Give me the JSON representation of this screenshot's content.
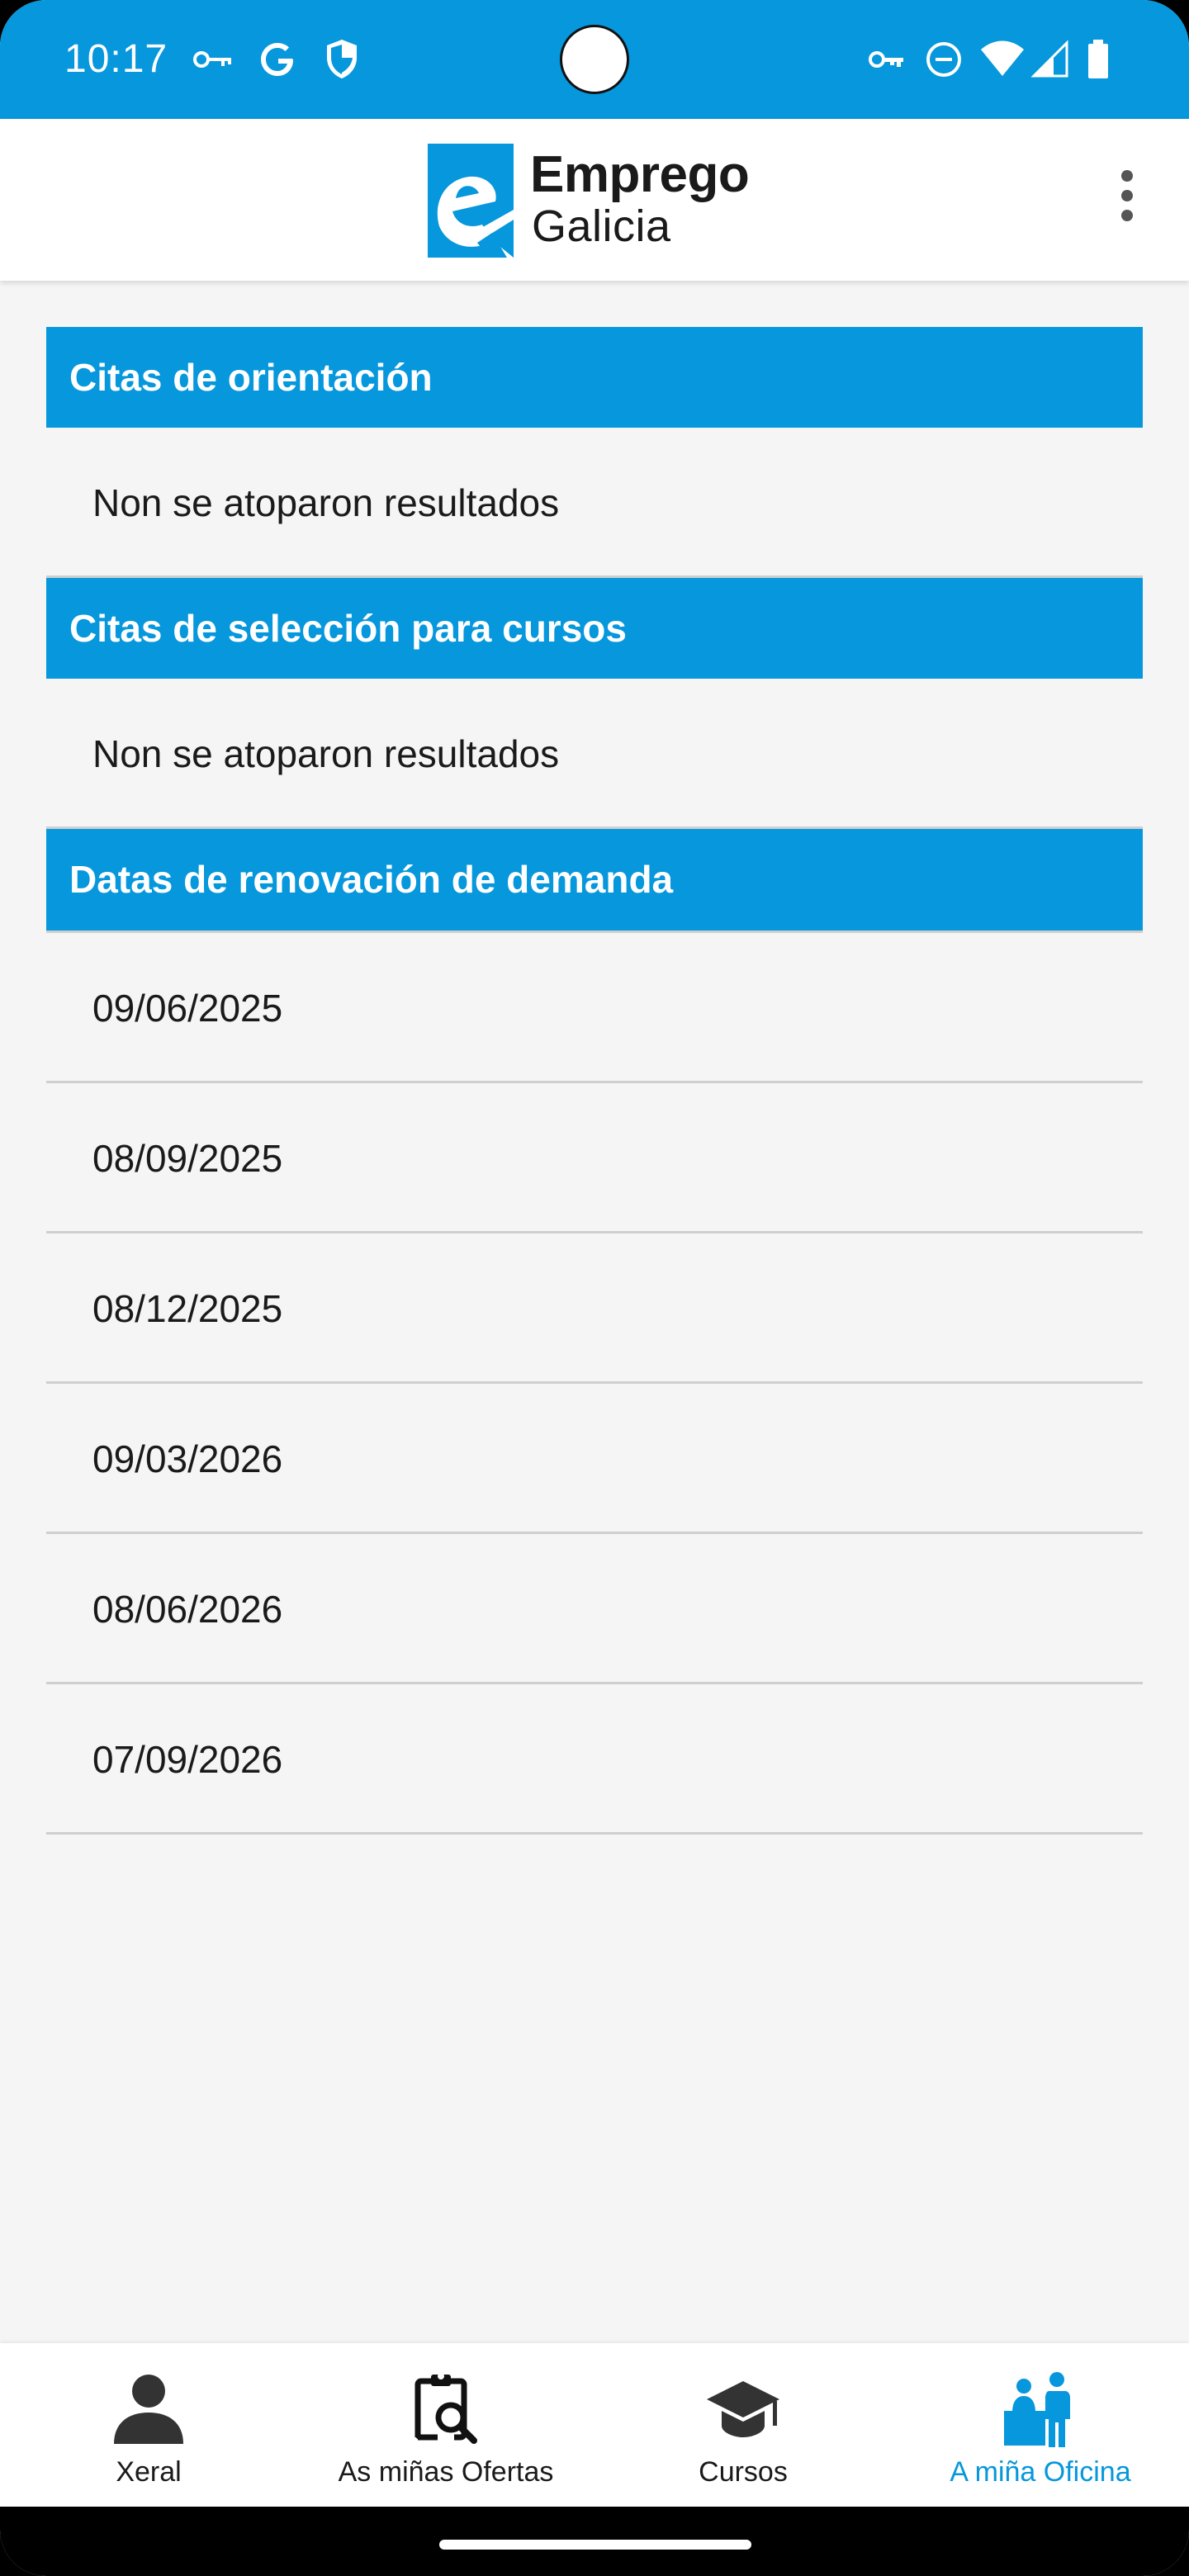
{
  "status_bar": {
    "time": "10:17",
    "left_icons": [
      "key-icon",
      "google-icon",
      "shield-icon"
    ],
    "right_icons": [
      "vpn-key-icon",
      "do-not-disturb-icon",
      "wifi-icon",
      "signal-icon",
      "battery-icon"
    ]
  },
  "app_bar": {
    "logo_line1": "Emprego",
    "logo_line2": "Galicia",
    "menu_icon": "more-vert-icon"
  },
  "sections": [
    {
      "title": "Citas de orientación",
      "rows": [
        "Non se atoparon resultados"
      ]
    },
    {
      "title": "Citas de selección para cursos",
      "rows": [
        "Non se atoparon resultados"
      ]
    },
    {
      "title": "Datas de renovación de demanda",
      "rows": [
        "09/06/2025",
        "08/09/2025",
        "08/12/2025",
        "09/03/2026",
        "08/06/2026",
        "07/09/2026"
      ]
    }
  ],
  "bottom_nav": {
    "items": [
      {
        "label": "Xeral",
        "icon": "person-icon",
        "active": false
      },
      {
        "label": "As miñas Ofertas",
        "icon": "clipboard-search-icon",
        "active": false
      },
      {
        "label": "Cursos",
        "icon": "graduation-cap-icon",
        "active": false
      },
      {
        "label": "A miña Oficina",
        "icon": "office-people-icon",
        "active": true
      }
    ]
  },
  "colors": {
    "primary": "#0697dc",
    "background": "#f5f5f5",
    "divider": "#cfcfcf",
    "text": "#1a1a1a"
  }
}
